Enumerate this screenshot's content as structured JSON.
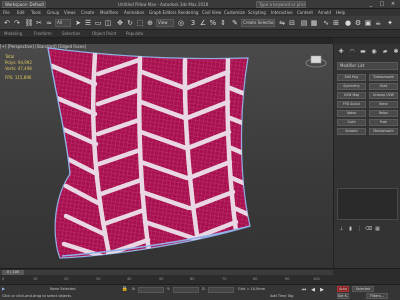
{
  "app": {
    "workspace_combo": "Workspace: Default",
    "title": "Untitled Pillow Max - Autodesk 3ds Max 2018",
    "search_placeholder": "Type a keyword or phrase",
    "window_controls": [
      "_",
      "□",
      "×"
    ]
  },
  "menu": [
    "File",
    "Edit",
    "Tools",
    "Group",
    "Views",
    "Create",
    "Modifiers",
    "Animation",
    "Graph Editors",
    "Rendering",
    "Civil View",
    "Customize",
    "Scripting",
    "Interactive",
    "Content",
    "Arnold",
    "Help"
  ],
  "toolbar": {
    "selection_filter": "All",
    "reference_coord": "View",
    "named_selection": "Create Selection Se"
  },
  "ribbon_tabs": [
    "Modeling",
    "Freeform",
    "Selection",
    "Object Paint",
    "Populate"
  ],
  "viewport": {
    "header": "[+] [Perspective] [Standard] [Edged Faces]",
    "stats_title": "Total",
    "stat_lines": [
      "Polys: 94,992",
      "Verts: 47,498",
      "FPS: 115,896"
    ]
  },
  "command_panel": {
    "tabs": [
      "create-icon",
      "modify-icon",
      "hierarchy-icon",
      "motion-icon",
      "display-icon",
      "utilities-icon"
    ],
    "modifier_list_label": "Modifier List",
    "modifier_buttons": [
      "Edit Poly",
      "Turbosmooth",
      "Symmetry",
      "Shell",
      "UVW Map",
      "Unwrap UVW",
      "FFD 4x4x4",
      "Bend",
      "Noise",
      "Relax",
      "Cloth",
      "Push",
      "Smooth",
      "Meshsmooth"
    ],
    "stack_icons": [
      "pin-stack-icon",
      "show-end-result-icon",
      "make-unique-icon",
      "remove-modifier-icon",
      "configure-sets-icon"
    ]
  },
  "timeline": {
    "frame_label": "0 / 100",
    "ticks": [
      "0",
      "10",
      "20",
      "30",
      "40",
      "50",
      "60",
      "70",
      "80",
      "90",
      "100"
    ]
  },
  "status": {
    "prompt": "Click or click-and-drag to select objects",
    "selection_info": "None Selected",
    "x_label": "X:",
    "y_label": "Y:",
    "z_label": "Z:",
    "grid_text": "Grid = 10,0mm",
    "add_time_tag": "Add Time Tag",
    "auto_key": "Auto",
    "set_key": "Set K.",
    "key_mode": "Selected",
    "key_filters": "Filters..."
  },
  "colors": {
    "pillow_fill": "#a8104f",
    "wire": "#d86a95",
    "stripes": "#e9d8e4",
    "edge_wire": "#8fb1e6",
    "stats_text": "#e1c75f"
  }
}
